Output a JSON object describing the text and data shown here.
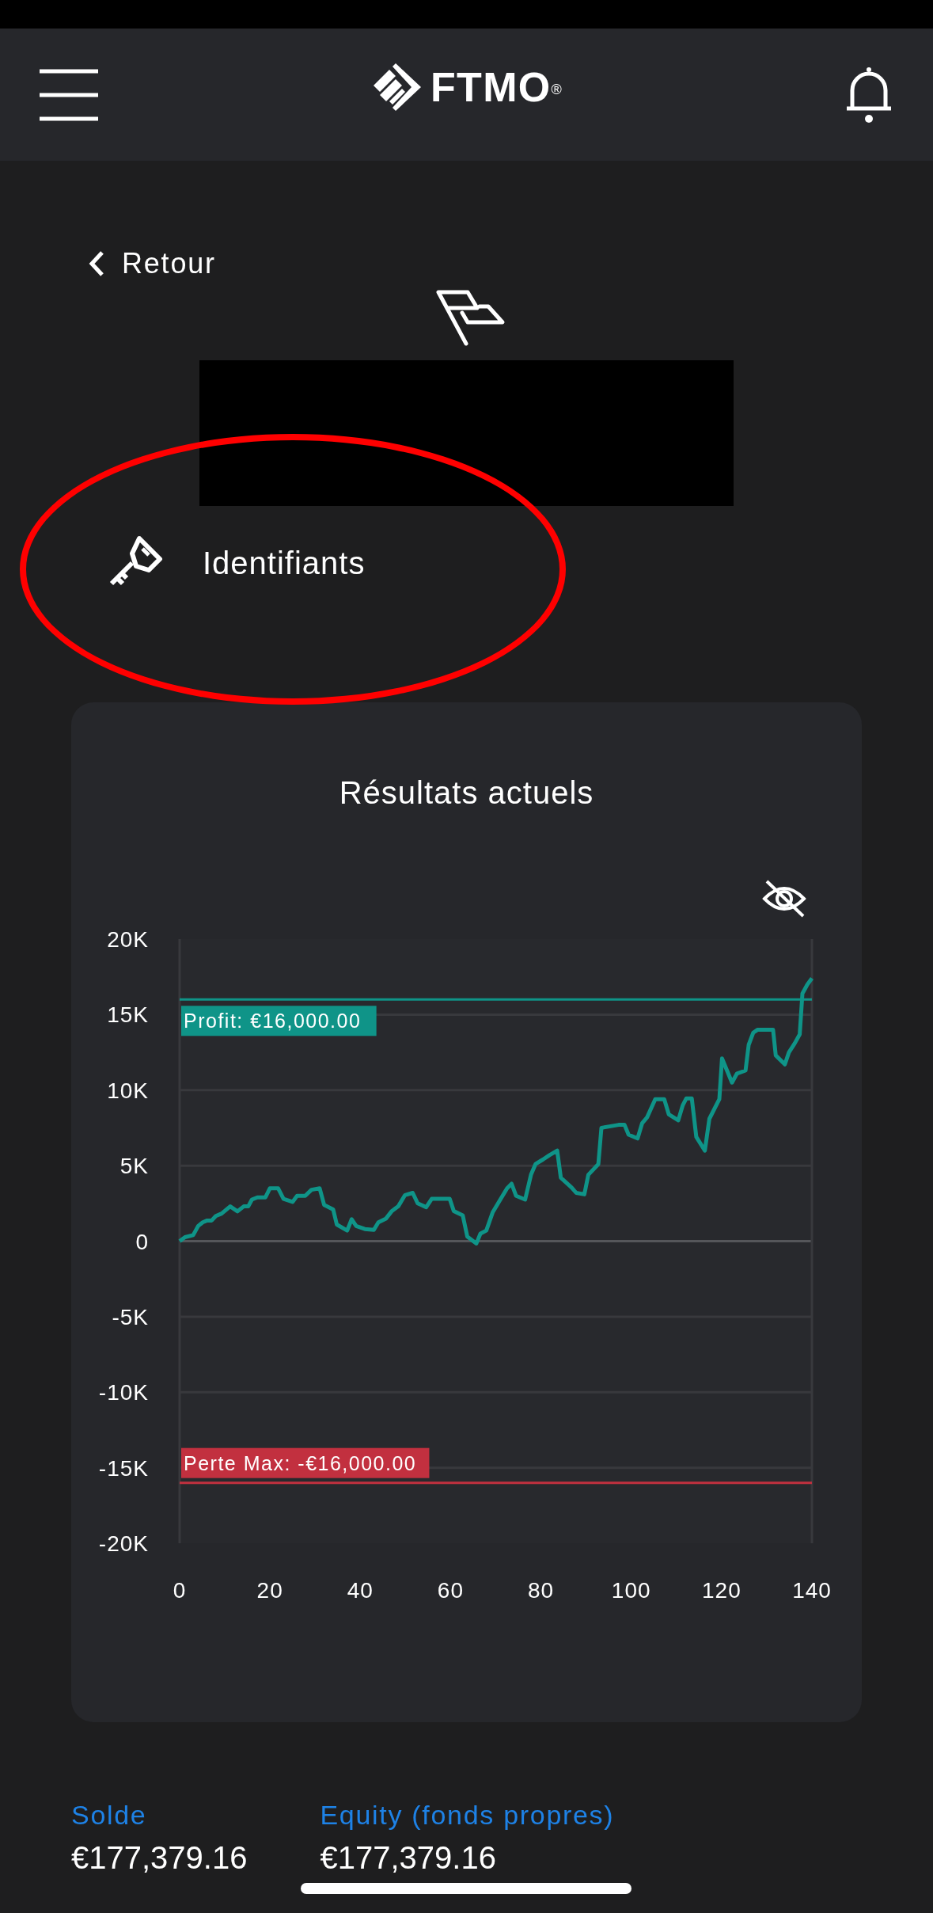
{
  "header": {
    "logo": "FTMO$^{®}$"
  },
  "back_link": "Retour",
  "credentials_link": "Identifiants",
  "results_card": {
    "title": "Résultats actuels",
    "chart_data": {
      "type": "line",
      "x": [
        0,
        1.2,
        3,
        4.1,
        5.1,
        6.1,
        7.1,
        8,
        9.3,
        11.2,
        12.8,
        14.2,
        15.2,
        16,
        17.2,
        19,
        20,
        21.8,
        23,
        25,
        26,
        27.8,
        29.2,
        31,
        32,
        34,
        34.8,
        37.1,
        38.1,
        39.1,
        41,
        43,
        44,
        45.7,
        47,
        48.4,
        49.9,
        51.6,
        52.7,
        54.6,
        55.8,
        59.8,
        60.7,
        62.7,
        63.7,
        65.7,
        66.6,
        67.9,
        69.3,
        71,
        72.5,
        73.5,
        74.5,
        76.5,
        77.8,
        78.8,
        80.4,
        81.9,
        83.6,
        84.4,
        86.8,
        87.8,
        89.6,
        90.5,
        92.7,
        93.4,
        96.2,
        97.2,
        98.5,
        99.4,
        101.4,
        102.4,
        103.5,
        105.3,
        107.3,
        108.3,
        110.4,
        111.4,
        112.2,
        113.4,
        114.4,
        116.3,
        117.3,
        119.5,
        120.1,
        122.3,
        123.4,
        125.3,
        126,
        127,
        128,
        131.4,
        132,
        134,
        134.9,
        136.2,
        137.3,
        137.9,
        139,
        140
      ],
      "grid": true,
      "series": [
        {
          "color": "#0f9488",
          "values": [
            0,
            0.26,
            0.4,
            1.0,
            1.25,
            1.37,
            1.37,
            1.66,
            1.83,
            2.3,
            1.97,
            2.3,
            2.3,
            2.75,
            2.9,
            2.9,
            3.5,
            3.5,
            2.8,
            2.6,
            3.0,
            3.0,
            3.4,
            3.5,
            2.4,
            2.1,
            1.1,
            0.7,
            1.45,
            1.0,
            0.8,
            0.75,
            1.25,
            1.5,
            2.0,
            2.3,
            3.05,
            3.2,
            2.5,
            2.25,
            2.8,
            2.8,
            2.0,
            1.7,
            0.3,
            -0.15,
            0.5,
            0.7,
            1.9,
            2.75,
            3.5,
            3.8,
            3.0,
            2.75,
            4.4,
            5.1,
            5.4,
            5.7,
            6.0,
            4.2,
            3.55,
            3.2,
            3.1,
            4.4,
            5.1,
            7.5,
            7.65,
            7.7,
            7.7,
            7.05,
            6.8,
            7.8,
            8.2,
            9.4,
            9.4,
            8.4,
            8.0,
            9.0,
            9.45,
            9.45,
            6.9,
            6.0,
            8.1,
            9.4,
            12.1,
            10.5,
            11.1,
            11.3,
            13.0,
            13.8,
            14.0,
            14.0,
            12.3,
            11.7,
            12.5,
            13.1,
            13.7,
            16.4,
            17.0,
            17.4
          ]
        }
      ],
      "xlim": [
        0,
        140
      ],
      "ylim": [
        -20,
        20
      ],
      "xticks": [
        0,
        20,
        40,
        60,
        80,
        100,
        120,
        140
      ],
      "yticks": [
        {
          "value": 20,
          "label": "20K"
        },
        {
          "value": 15,
          "label": "15K"
        },
        {
          "value": 10,
          "label": "10K"
        },
        {
          "value": 5,
          "label": "5K"
        },
        {
          "value": 0,
          "label": "0"
        },
        {
          "value": -5,
          "label": "-5K"
        },
        {
          "value": -10,
          "label": "-10K"
        },
        {
          "value": -15,
          "label": "-15K"
        },
        {
          "value": -20,
          "label": "-20K"
        }
      ],
      "ref_lines": [
        {
          "axis": "y",
          "value": 16,
          "label": "Profit: €16,000.00",
          "color": "#0f9488"
        },
        {
          "axis": "y",
          "value": -16,
          "label": "Perte Max: -€16,000.00",
          "color": "#c2303f"
        }
      ]
    }
  },
  "stats": [
    {
      "label": "Solde",
      "value": "€177,379.16"
    },
    {
      "label": "Equity (fonds propres)",
      "value": "€177,379.16"
    }
  ]
}
